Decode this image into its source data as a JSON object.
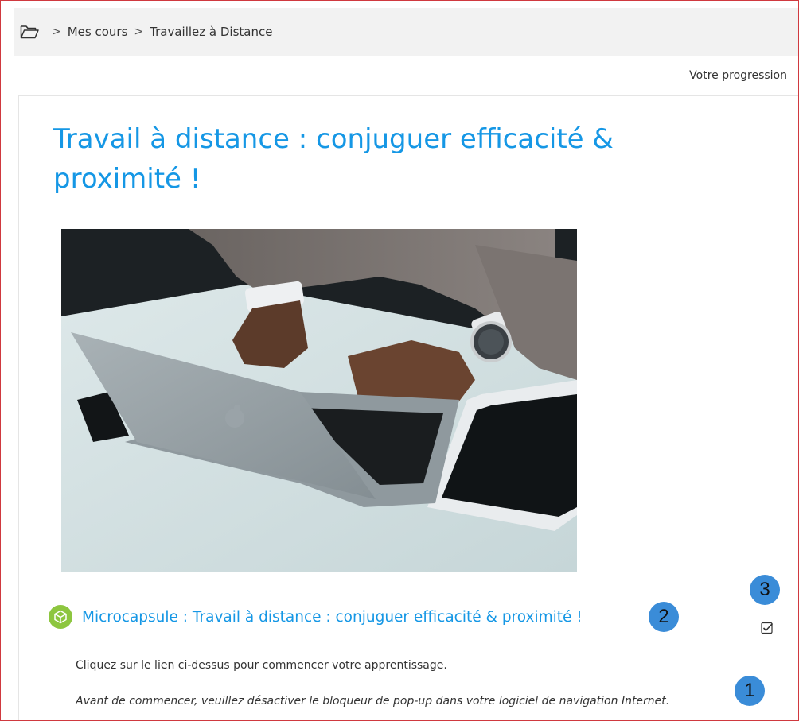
{
  "breadcrumb": {
    "home_icon": "folder-open-icon",
    "items": [
      "Mes cours",
      "Travaillez à Distance"
    ],
    "separator": ">"
  },
  "header": {
    "progress_label": "Votre progression"
  },
  "main": {
    "title": "Travail à distance : conjuguer efficacité & proximité !",
    "image_icon": "laptop-photo",
    "activity": {
      "icon": "scorm-package-icon",
      "link": "Microcapsule : Travail à distance : conjuguer efficacité & proximité !",
      "completion_icon": "checkbox-checked-icon"
    },
    "instructions": [
      "Cliquez sur le lien ci-dessus pour commencer votre apprentissage.",
      "Avant de commencer, veuillez désactiver le bloqueur de pop-up dans votre logiciel de navigation Internet."
    ]
  },
  "annotations": [
    "1",
    "2",
    "3"
  ],
  "colors": {
    "accent": "#1597e5",
    "frame": "#d0393f",
    "badge": "#3a8cd8",
    "activity_icon": "#8dc63f"
  }
}
